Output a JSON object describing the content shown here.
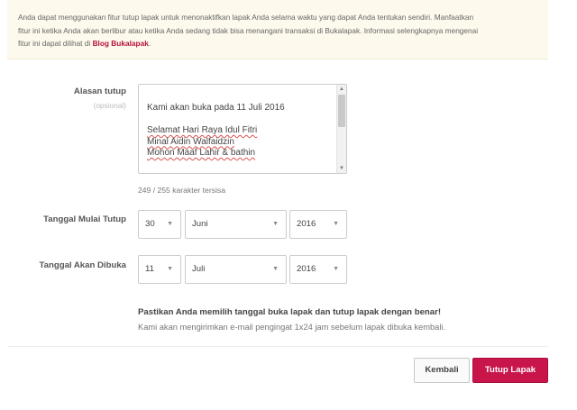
{
  "notice": {
    "line1": "Anda dapat menggunakan fitur tutup lapak untuk menonaktifkan lapak Anda selama waktu yang dapat Anda tentukan sendiri. Manfaatkan",
    "line2": "fitur ini ketika Anda akan berlibur atau ketika Anda sedang tidak bisa menangani transaksi di Bukalapak. Informasi selengkapnya mengenai",
    "line3_prefix": "fitur ini dapat dilihat di ",
    "link": "Blog Bukalapak",
    "line3_suffix": "."
  },
  "reason": {
    "label": "Alasan tutup",
    "sublabel": "(opsional)",
    "lines": [
      "Kami akan buka pada 11 Juli 2016",
      "",
      "Selamat Hari Raya Idul Fitri",
      "Minal Aidin Walfaidzin",
      "Mohon Maaf Lahir & bathin"
    ],
    "char_count": "249 / 255 karakter tersisa"
  },
  "start_date": {
    "label": "Tanggal Mulai Tutup",
    "day": "30",
    "month": "Juni",
    "year": "2016"
  },
  "open_date": {
    "label": "Tanggal Akan Dibuka",
    "day": "11",
    "month": "Juli",
    "year": "2016"
  },
  "warning": {
    "title": "Pastikan Anda memilih tanggal buka lapak dan tutup lapak dengan benar!",
    "text": "Kami akan mengirimkan e-mail pengingat 1x24 jam sebelum lapak dibuka kembali."
  },
  "buttons": {
    "back": "Kembali",
    "close": "Tutup Lapak"
  },
  "icons": {
    "caret": "chevron-down-icon",
    "scroll_up": "arrow-up-icon",
    "scroll_down": "arrow-down-icon"
  },
  "colors": {
    "accent": "#c8164b",
    "link": "#b5123e",
    "notice_bg": "#fdf9ec"
  }
}
